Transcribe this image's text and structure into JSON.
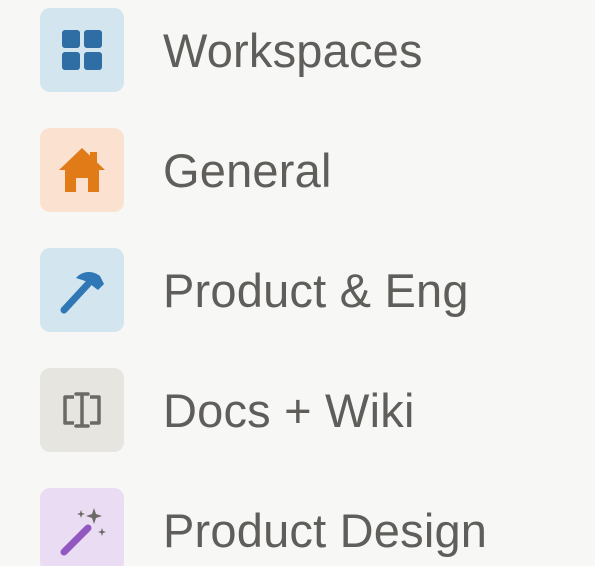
{
  "sidebar": {
    "items": [
      {
        "label": "Workspaces",
        "icon": "grid-icon",
        "tile_color": "#d3e5ef",
        "icon_color": "#2f6ea5"
      },
      {
        "label": "General",
        "icon": "home-icon",
        "tile_color": "#fbe2d0",
        "icon_color": "#e07b17"
      },
      {
        "label": "Product & Eng",
        "icon": "hammer-icon",
        "tile_color": "#d3e5ef",
        "icon_color": "#2f78b5"
      },
      {
        "label": "Docs + Wiki",
        "icon": "text-cursor-icon",
        "tile_color": "#e6e5e0",
        "icon_color": "#6b6a66"
      },
      {
        "label": "Product Design",
        "icon": "magic-wand-icon",
        "tile_color": "#eadcf2",
        "icon_color": "#9357c2"
      }
    ]
  }
}
